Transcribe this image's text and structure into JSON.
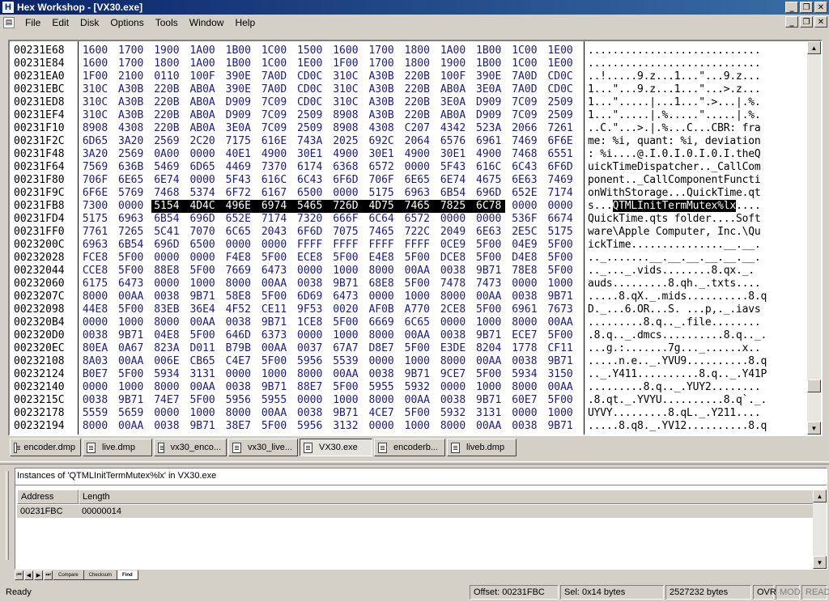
{
  "window": {
    "app_letter": "H",
    "title": "Hex Workshop - [VX30.exe]"
  },
  "menu": [
    "File",
    "Edit",
    "Disk",
    "Options",
    "Tools",
    "Window",
    "Help"
  ],
  "hex": {
    "rows": [
      {
        "addr": "00231E68",
        "bytes": [
          "1600",
          "1700",
          "1900",
          "1A00",
          "1B00",
          "1C00",
          "1500",
          "1600",
          "1700",
          "1800",
          "1A00",
          "1B00",
          "1C00",
          "1E00"
        ],
        "ascii": "............................"
      },
      {
        "addr": "00231E84",
        "bytes": [
          "1600",
          "1700",
          "1800",
          "1A00",
          "1B00",
          "1C00",
          "1E00",
          "1F00",
          "1700",
          "1800",
          "1900",
          "1B00",
          "1C00",
          "1E00"
        ],
        "ascii": "............................"
      },
      {
        "addr": "00231EA0",
        "bytes": [
          "1F00",
          "2100",
          "0110",
          "100F",
          "390E",
          "7A0D",
          "CD0C",
          "310C",
          "A30B",
          "220B",
          "100F",
          "390E",
          "7A0D",
          "CD0C"
        ],
        "ascii": "..!.....9.z...1...\"...9.z..."
      },
      {
        "addr": "00231EBC",
        "bytes": [
          "310C",
          "A30B",
          "220B",
          "AB0A",
          "390E",
          "7A0D",
          "CD0C",
          "310C",
          "A30B",
          "220B",
          "AB0A",
          "3E0A",
          "7A0D",
          "CD0C"
        ],
        "ascii": "1...\"...9.z...1...\"...>.z..."
      },
      {
        "addr": "00231ED8",
        "bytes": [
          "310C",
          "A30B",
          "220B",
          "AB0A",
          "D909",
          "7C09",
          "CD0C",
          "310C",
          "A30B",
          "220B",
          "3E0A",
          "D909",
          "7C09",
          "2509"
        ],
        "ascii": "1...\".....|...1...\".>...|.%."
      },
      {
        "addr": "00231EF4",
        "bytes": [
          "310C",
          "A30B",
          "220B",
          "AB0A",
          "D909",
          "7C09",
          "2509",
          "8908",
          "A30B",
          "220B",
          "AB0A",
          "D909",
          "7C09",
          "2509"
        ],
        "ascii": "1...\".....|.%.....\".....|.%."
      },
      {
        "addr": "00231F10",
        "bytes": [
          "8908",
          "4308",
          "220B",
          "AB0A",
          "3E0A",
          "7C09",
          "2509",
          "8908",
          "4308",
          "C207",
          "4342",
          "523A",
          "2066",
          "7261"
        ],
        "ascii": "..C.\"...>.|.%...C...CBR: fra"
      },
      {
        "addr": "00231F2C",
        "bytes": [
          "6D65",
          "3A20",
          "2569",
          "2C20",
          "7175",
          "616E",
          "743A",
          "2025",
          "692C",
          "2064",
          "6576",
          "6961",
          "7469",
          "6F6E"
        ],
        "ascii": "me: %i, quant: %i, deviation"
      },
      {
        "addr": "00231F48",
        "bytes": [
          "3A20",
          "2569",
          "0A00",
          "0000",
          "40E1",
          "4900",
          "30E1",
          "4900",
          "30E1",
          "4900",
          "30E1",
          "4900",
          "7468",
          "6551"
        ],
        "ascii": ": %i....@.I.0.I.0.I.0.I.theQ"
      },
      {
        "addr": "00231F64",
        "bytes": [
          "7569",
          "636B",
          "5469",
          "6D65",
          "4469",
          "7370",
          "6174",
          "6368",
          "6572",
          "0000",
          "5F43",
          "616C",
          "6C43",
          "6F6D"
        ],
        "ascii": "uickTimeDispatcher.._CallCom"
      },
      {
        "addr": "00231F80",
        "bytes": [
          "706F",
          "6E65",
          "6E74",
          "0000",
          "5F43",
          "616C",
          "6C43",
          "6F6D",
          "706F",
          "6E65",
          "6E74",
          "4675",
          "6E63",
          "7469"
        ],
        "ascii": "ponent.._CallComponentFuncti"
      },
      {
        "addr": "00231F9C",
        "bytes": [
          "6F6E",
          "5769",
          "7468",
          "5374",
          "6F72",
          "6167",
          "6500",
          "0000",
          "5175",
          "6963",
          "6B54",
          "696D",
          "652E",
          "7174"
        ],
        "ascii": "onWithStorage...QuickTime.qt"
      },
      {
        "addr": "00231FB8",
        "bytes": [
          "7300",
          "0000",
          "5154",
          "4D4C",
          "496E",
          "6974",
          "5465",
          "726D",
          "4D75",
          "7465",
          "7825",
          "6C78",
          "0000",
          "0000"
        ],
        "ascii": "s...QTMLInitTermMutex%lx....",
        "sel_start": 2,
        "sel_end": 11
      },
      {
        "addr": "00231FD4",
        "bytes": [
          "5175",
          "6963",
          "6B54",
          "696D",
          "652E",
          "7174",
          "7320",
          "666F",
          "6C64",
          "6572",
          "0000",
          "0000",
          "536F",
          "6674"
        ],
        "ascii": "QuickTime.qts folder....Soft"
      },
      {
        "addr": "00231FF0",
        "bytes": [
          "7761",
          "7265",
          "5C41",
          "7070",
          "6C65",
          "2043",
          "6F6D",
          "7075",
          "7465",
          "722C",
          "2049",
          "6E63",
          "2E5C",
          "5175"
        ],
        "ascii": "ware\\Apple Computer, Inc.\\Qu"
      },
      {
        "addr": "0023200C",
        "bytes": [
          "6963",
          "6B54",
          "696D",
          "6500",
          "0000",
          "0000",
          "FFFF",
          "FFFF",
          "FFFF",
          "FFFF",
          "0CE9",
          "5F00",
          "04E9",
          "5F00"
        ],
        "ascii": "ickTime...............__.__."
      },
      {
        "addr": "00232028",
        "bytes": [
          "FCE8",
          "5F00",
          "0000",
          "0000",
          "F4E8",
          "5F00",
          "ECE8",
          "5F00",
          "E4E8",
          "5F00",
          "DCE8",
          "5F00",
          "D4E8",
          "5F00"
        ],
        "ascii": ".._.......__.__.__.__.__.__."
      },
      {
        "addr": "00232044",
        "bytes": [
          "CCE8",
          "5F00",
          "88E8",
          "5F00",
          "7669",
          "6473",
          "0000",
          "1000",
          "8000",
          "00AA",
          "0038",
          "9B71",
          "78E8",
          "5F00"
        ],
        "ascii": ".._..._.vids........8.qx._."
      },
      {
        "addr": "00232060",
        "bytes": [
          "6175",
          "6473",
          "0000",
          "1000",
          "8000",
          "00AA",
          "0038",
          "9B71",
          "68E8",
          "5F00",
          "7478",
          "7473",
          "0000",
          "1000"
        ],
        "ascii": "auds.........8.qh._.txts...."
      },
      {
        "addr": "0023207C",
        "bytes": [
          "8000",
          "00AA",
          "0038",
          "9B71",
          "58E8",
          "5F00",
          "6D69",
          "6473",
          "0000",
          "1000",
          "8000",
          "00AA",
          "0038",
          "9B71"
        ],
        "ascii": ".....8.qX._.mids..........8.q"
      },
      {
        "addr": "00232098",
        "bytes": [
          "44E8",
          "5F00",
          "83EB",
          "36E4",
          "4F52",
          "CE11",
          "9F53",
          "0020",
          "AF0B",
          "A770",
          "2CE8",
          "5F00",
          "6961",
          "7673"
        ],
        "ascii": "D._...6.OR...S. ...p,._.iavs"
      },
      {
        "addr": "002320B4",
        "bytes": [
          "0000",
          "1000",
          "8000",
          "00AA",
          "0038",
          "9B71",
          "1CE8",
          "5F00",
          "6669",
          "6C65",
          "0000",
          "1000",
          "8000",
          "00AA"
        ],
        "ascii": ".........8.q.._.file........"
      },
      {
        "addr": "002320D0",
        "bytes": [
          "0038",
          "9B71",
          "04E8",
          "5F00",
          "646D",
          "6373",
          "0000",
          "1000",
          "8000",
          "00AA",
          "0038",
          "9B71",
          "ECE7",
          "5F00"
        ],
        "ascii": ".8.q.._.dmcs..........8.q.._."
      },
      {
        "addr": "002320EC",
        "bytes": [
          "80EA",
          "0A67",
          "823A",
          "D011",
          "B79B",
          "00AA",
          "0037",
          "67A7",
          "D8E7",
          "5F00",
          "E3DE",
          "8204",
          "1778",
          "CF11"
        ],
        "ascii": "...g.:.......7g..._......x.."
      },
      {
        "addr": "00232108",
        "bytes": [
          "8A03",
          "00AA",
          "006E",
          "CB65",
          "C4E7",
          "5F00",
          "5956",
          "5539",
          "0000",
          "1000",
          "8000",
          "00AA",
          "0038",
          "9B71"
        ],
        "ascii": ".....n.e.._.YVU9..........8.q"
      },
      {
        "addr": "00232124",
        "bytes": [
          "B0E7",
          "5F00",
          "5934",
          "3131",
          "0000",
          "1000",
          "8000",
          "00AA",
          "0038",
          "9B71",
          "9CE7",
          "5F00",
          "5934",
          "3150"
        ],
        "ascii": ".._.Y411..........8.q.._.Y41P"
      },
      {
        "addr": "00232140",
        "bytes": [
          "0000",
          "1000",
          "8000",
          "00AA",
          "0038",
          "9B71",
          "88E7",
          "5F00",
          "5955",
          "5932",
          "0000",
          "1000",
          "8000",
          "00AA"
        ],
        "ascii": ".........8.q.._.YUY2........"
      },
      {
        "addr": "0023215C",
        "bytes": [
          "0038",
          "9B71",
          "74E7",
          "5F00",
          "5956",
          "5955",
          "0000",
          "1000",
          "8000",
          "00AA",
          "0038",
          "9B71",
          "60E7",
          "5F00"
        ],
        "ascii": ".8.qt._.YVYU..........8.q`._."
      },
      {
        "addr": "00232178",
        "bytes": [
          "5559",
          "5659",
          "0000",
          "1000",
          "8000",
          "00AA",
          "0038",
          "9B71",
          "4CE7",
          "5F00",
          "5932",
          "3131",
          "0000",
          "1000"
        ],
        "ascii": "UYVY.........8.qL._.Y211...."
      },
      {
        "addr": "00232194",
        "bytes": [
          "8000",
          "00AA",
          "0038",
          "9B71",
          "38E7",
          "5F00",
          "5956",
          "3132",
          "0000",
          "1000",
          "8000",
          "00AA",
          "0038",
          "9B71"
        ],
        "ascii": ".....8.q8._.YV12..........8.q"
      }
    ]
  },
  "doc_tabs": [
    {
      "label": "encoder.dmp",
      "active": false
    },
    {
      "label": "live.dmp",
      "active": false
    },
    {
      "label": "vx30_enco...",
      "active": false
    },
    {
      "label": "vx30_live...",
      "active": false
    },
    {
      "label": "VX30.exe",
      "active": true
    },
    {
      "label": "encoderb...",
      "active": false
    },
    {
      "label": "liveb.dmp",
      "active": false
    }
  ],
  "results": {
    "title": "Instances of 'QTMLInitTermMutex%lx' in VX30.exe",
    "col_address": "Address",
    "col_length": "Length",
    "row_address": "00231FBC",
    "row_length": "00000014"
  },
  "bottom_tabs": [
    "Compare",
    "Checksum",
    "Find"
  ],
  "status": {
    "ready": "Ready",
    "offset": "Offset: 00231FBC",
    "sel": "Sel: 0x14 bytes",
    "size": "2527232 bytes",
    "ovr": "OVR",
    "mod": "MOD",
    "read": "READ"
  }
}
